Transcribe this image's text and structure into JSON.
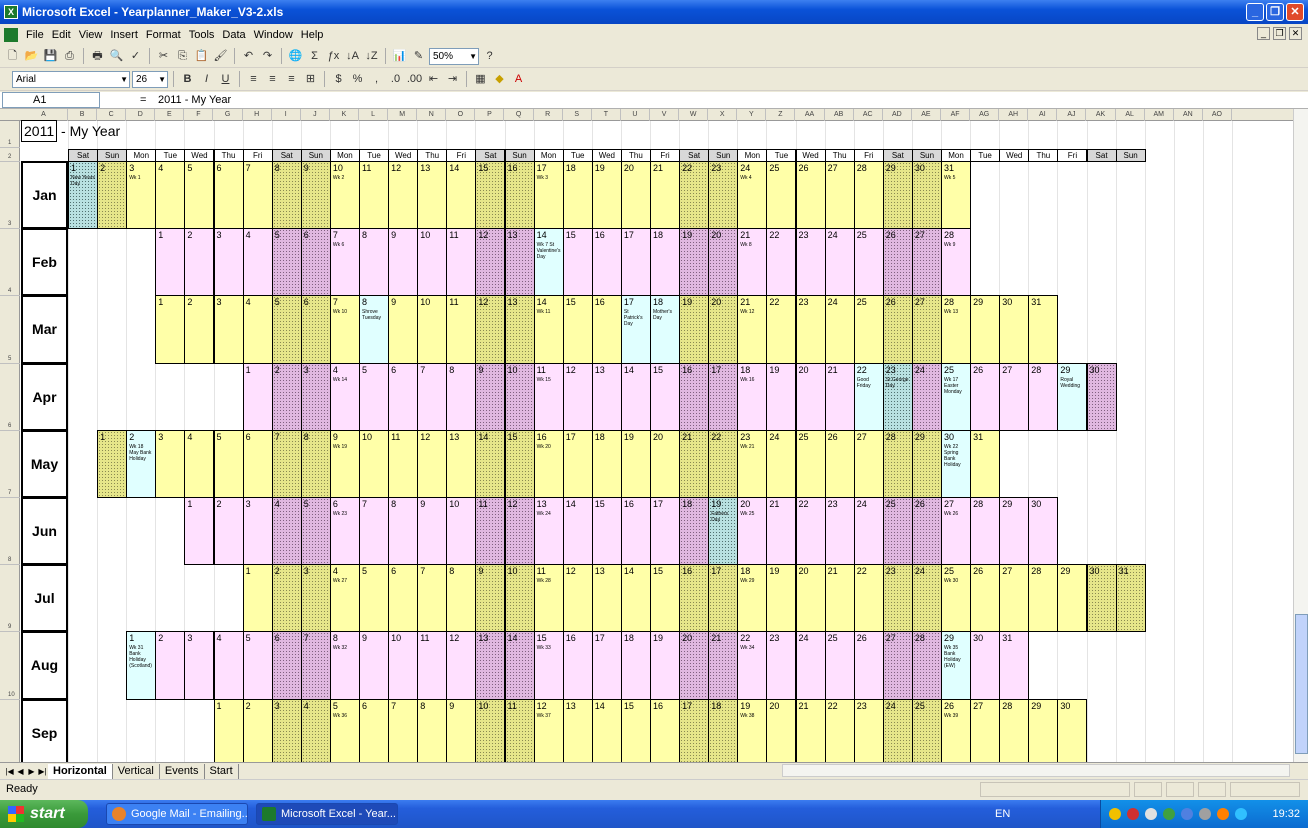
{
  "window": {
    "title": "Microsoft Excel - Yearplanner_Maker_V3-2.xls"
  },
  "menu": [
    "File",
    "Edit",
    "View",
    "Insert",
    "Format",
    "Tools",
    "Data",
    "Window",
    "Help"
  ],
  "toolbar": {
    "zoom": "50%",
    "font": "Arial",
    "size": "26"
  },
  "formula_bar": {
    "cell_ref": "A1",
    "fx": "=",
    "content": "2011 - My Year"
  },
  "sheet": {
    "title_year": "2011",
    "title_text": "My Year",
    "columns": [
      "A",
      "B",
      "C",
      "D",
      "E",
      "F",
      "G",
      "H",
      "I",
      "J",
      "K",
      "L",
      "M",
      "N",
      "O",
      "P",
      "Q",
      "R",
      "S",
      "T",
      "U",
      "V",
      "W",
      "X",
      "Y",
      "Z",
      "AA",
      "AB",
      "AC",
      "AD",
      "AE",
      "AF",
      "AG",
      "AH",
      "AI",
      "AJ",
      "AK",
      "AL",
      "AM",
      "AN",
      "AO"
    ],
    "rows": [
      "1",
      "2",
      "3",
      "4",
      "5",
      "6",
      "7",
      "8",
      "9",
      "10"
    ],
    "day_headers": [
      "Sat",
      "Sun",
      "Mon",
      "Tue",
      "Wed",
      "Thu",
      "Fri",
      "Sat",
      "Sun",
      "Mon",
      "Tue",
      "Wed",
      "Thu",
      "Fri",
      "Sat",
      "Sun",
      "Mon",
      "Tue",
      "Wed",
      "Thu",
      "Fri",
      "Sat",
      "Sun",
      "Mon",
      "Tue",
      "Wed",
      "Thu",
      "Fri",
      "Sat",
      "Sun",
      "Mon",
      "Tue",
      "Wed",
      "Thu",
      "Fri",
      "Sat",
      "Sun"
    ],
    "months": [
      {
        "name": "Jan",
        "start": 0,
        "days": 31,
        "tone": "y",
        "annotations": {
          "1": "New Years Day",
          "3": "Wk 1",
          "10": "Wk 2",
          "17": "Wk 3",
          "24": "Wk 4",
          "31": "Wk 5"
        },
        "holidays": [
          1
        ]
      },
      {
        "name": "Feb",
        "start": 3,
        "days": 28,
        "tone": "p",
        "annotations": {
          "7": "Wk 6",
          "14": "Wk 7 St Valentine's Day",
          "21": "Wk 8",
          "28": "Wk 9"
        },
        "holidays": [
          14
        ]
      },
      {
        "name": "Mar",
        "start": 3,
        "days": 31,
        "tone": "y",
        "annotations": {
          "7": "Wk 10",
          "8": "Shrove Tuesday",
          "14": "Wk 11",
          "17": "St Patrick's Day",
          "18": "Mother's Day",
          "21": "Wk 12",
          "28": "Wk 13"
        },
        "holidays": [
          8,
          17,
          18
        ]
      },
      {
        "name": "Apr",
        "start": 6,
        "days": 30,
        "tone": "p",
        "annotations": {
          "4": "Wk 14",
          "11": "Wk 15",
          "18": "Wk 16",
          "22": "Good Friday",
          "23": "St George Day",
          "25": "Wk 17 Easter Monday",
          "29": "Royal Wedding"
        },
        "holidays": [
          22,
          23,
          25,
          29
        ]
      },
      {
        "name": "May",
        "start": 1,
        "days": 31,
        "tone": "y",
        "annotations": {
          "2": "Wk 18 May Bank Holiday",
          "9": "Wk 19",
          "16": "Wk 20",
          "23": "Wk 21",
          "30": "Wk 22 Spring Bank Holiday"
        },
        "holidays": [
          2,
          30
        ]
      },
      {
        "name": "Jun",
        "start": 4,
        "days": 30,
        "tone": "p",
        "annotations": {
          "6": "Wk 23",
          "13": "Wk 24",
          "19": "Fathers Day",
          "20": "Wk 25",
          "27": "Wk 26"
        },
        "holidays": [
          19
        ]
      },
      {
        "name": "Jul",
        "start": 6,
        "days": 31,
        "tone": "y",
        "annotations": {
          "4": "Wk 27",
          "11": "Wk 28",
          "18": "Wk 29",
          "25": "Wk 30"
        },
        "holidays": []
      },
      {
        "name": "Aug",
        "start": 2,
        "days": 31,
        "tone": "p",
        "annotations": {
          "1": "Wk 31 Bank Holiday (Scotland)",
          "8": "Wk 32",
          "15": "Wk 33",
          "22": "Wk 34",
          "29": "Wk 35 Bank Holiday (EW)"
        },
        "holidays": [
          1,
          29
        ]
      },
      {
        "name": "Sep",
        "start": 5,
        "days": 30,
        "tone": "y",
        "annotations": {
          "5": "Wk 36",
          "12": "Wk 37",
          "19": "Wk 38",
          "26": "Wk 39"
        },
        "holidays": []
      }
    ]
  },
  "sheet_tabs": [
    "Horizontal",
    "Vertical",
    "Events",
    "Start"
  ],
  "status": "Ready",
  "taskbar": {
    "start": "start",
    "items": [
      "Google Mail - Emailing...",
      "Microsoft Excel - Year..."
    ],
    "lang": "EN",
    "clock": "19:32"
  }
}
